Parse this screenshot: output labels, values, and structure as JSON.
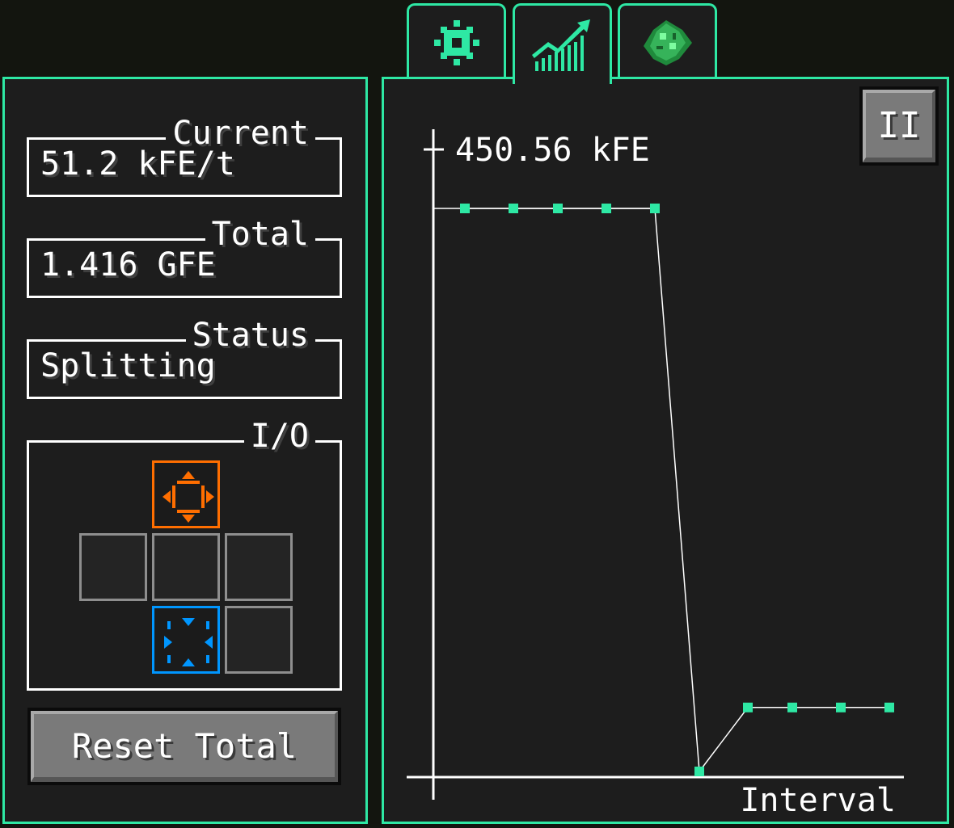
{
  "tabs": [
    {
      "name": "settings",
      "icon": "gear-icon",
      "active": false
    },
    {
      "name": "statistics",
      "icon": "chart-icon",
      "active": true
    },
    {
      "name": "upgrades",
      "icon": "emerald-icon",
      "active": false
    }
  ],
  "stats": {
    "current": {
      "label": "Current",
      "value": "51.2 kFE/t"
    },
    "total": {
      "label": "Total",
      "value": "1.416 GFE"
    },
    "status": {
      "label": "Status",
      "value": "Splitting"
    }
  },
  "io": {
    "label": "I/O",
    "slots": [
      {
        "position": "top",
        "mode": "output",
        "color": "#ff6e00"
      },
      {
        "position": "left",
        "mode": "none"
      },
      {
        "position": "center",
        "mode": "none"
      },
      {
        "position": "right",
        "mode": "none"
      },
      {
        "position": "bottom",
        "mode": "input",
        "color": "#0096ff"
      },
      {
        "position": "back",
        "mode": "none"
      }
    ]
  },
  "reset_button": {
    "label": "Reset Total"
  },
  "pause_button": {
    "label": "II"
  },
  "colors": {
    "accent": "#2ee8a4",
    "output": "#ff6e00",
    "input": "#0096ff"
  },
  "chart_data": {
    "type": "line",
    "ymax_label": "450.56 kFE",
    "xlabel": "Interval",
    "ylim": [
      0,
      450.56
    ],
    "unit": "kFE",
    "x": [
      1,
      2,
      3,
      4,
      5,
      6,
      7,
      8,
      9,
      10
    ],
    "values": [
      450.56,
      450.56,
      450.56,
      450.56,
      450.56,
      0,
      51.2,
      51.2,
      51.2,
      51.2
    ]
  }
}
